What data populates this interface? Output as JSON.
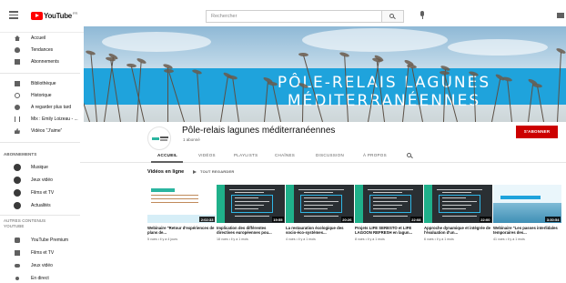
{
  "topbar": {
    "logo_text": "YouTube",
    "logo_region": "FR",
    "search_placeholder": "Rechercher"
  },
  "sidebar": {
    "items": [
      {
        "label": "Accueil",
        "icon": "home-icon"
      },
      {
        "label": "Tendances",
        "icon": "fire-icon"
      },
      {
        "label": "Abonnements",
        "icon": "subscriptions-icon"
      },
      {
        "label": "Bibliothèque",
        "icon": "library-icon"
      },
      {
        "label": "Historique",
        "icon": "history-icon"
      },
      {
        "label": "À regarder plus tard",
        "icon": "clock-icon"
      },
      {
        "label": "Mix : Emily Loizeau - ...",
        "icon": "mix-icon"
      },
      {
        "label": "Vidéos \"J'aime\"",
        "icon": "thumb-up-icon"
      }
    ],
    "subs_heading": "ABONNEMENTS",
    "subs": [
      {
        "label": "Musique"
      },
      {
        "label": "Jeux vidéo"
      },
      {
        "label": "Films et TV"
      },
      {
        "label": "Actualités"
      }
    ],
    "more_heading": "AUTRES CONTENUS YOUTUBE",
    "more": [
      {
        "label": "YouTube Premium",
        "icon": "youtube-icon"
      },
      {
        "label": "Films et TV",
        "icon": "film-icon"
      },
      {
        "label": "Jeux vidéo",
        "icon": "gamepad-icon"
      },
      {
        "label": "En direct",
        "icon": "live-icon"
      }
    ]
  },
  "banner": {
    "title": "PÔLE-RELAIS LAGUNES MÉDITERRANÉENNES"
  },
  "channel": {
    "name": "Pôle-relais lagunes méditerranéennes",
    "subscribers": "1 abonné",
    "subscribe_label": "S'ABONNER"
  },
  "tabs": [
    "ACCUEIL",
    "VIDÉOS",
    "PLAYLISTS",
    "CHAÎNES",
    "DISCUSSION",
    "À PROPOS"
  ],
  "videos_section": {
    "title": "Vidéos en ligne",
    "play_all": "TOUT REGARDER"
  },
  "videos": [
    {
      "title": "Webinaire \"Retour d'expériences de plans de...",
      "meta": "5 vues • il y a 4 jours",
      "duration": "2:02:33"
    },
    {
      "title": "Implication des différentes directives européennes pou...",
      "meta": "18 vues • il y a 1 mois",
      "duration": "19:55"
    },
    {
      "title": "La restauration écologique des socio-éco-systèmes...",
      "meta": "4 vues • il y a 1 mois",
      "duration": "20:26"
    },
    {
      "title": "Projets LIFE SERESTO et LIFE LAGOON REFRESH en lagun...",
      "meta": "8 vues • il y a 1 mois",
      "duration": "22:08"
    },
    {
      "title": "Approche dynamique et intégrée de l'évaluation d'un...",
      "meta": "6 vues • il y a 1 mois",
      "duration": "22:00"
    },
    {
      "title": "Webinaire \"Les passes interlidales temporaires des...",
      "meta": "41 vues • il y a 1 mois",
      "duration": "3:30:54"
    }
  ],
  "colors": {
    "brand_red": "#ff0000",
    "subscribe_red": "#cc0000",
    "banner_blue": "#1fa3dc"
  }
}
